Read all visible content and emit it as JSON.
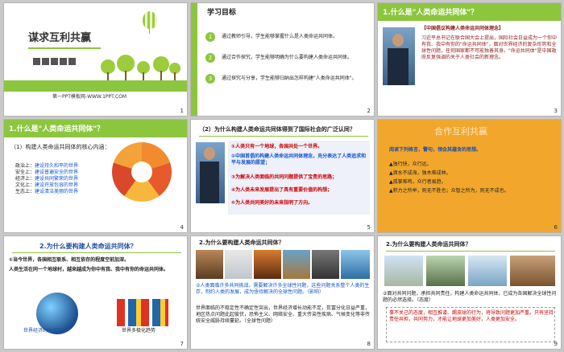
{
  "slides": [
    {
      "num": "1",
      "title": "谋求互利共赢",
      "footer": "第一PPT模板网-WWW.1PPT.COM"
    },
    {
      "num": "2",
      "title": "学习目标",
      "items": [
        "通过教师引导，学生能够掌握什么是人类命运共同体。",
        "通过合作探究，学生能够明确为什么要构建人类命运共同体。",
        "通过探究与分享，学生能够归纳出怎样构建\"人类命运共同体\"。"
      ]
    },
    {
      "num": "3",
      "title": "1.什么是\"人类命运共同体\"？",
      "box_title": "【中国倡议构建人类命运共同体理念】",
      "box_text": "习近平总书记在联合国大会上提出，国际社会日益成为一个你中有我、我中有你的\"命运共同体\"，面对世界经济的复杂形势和全球性问题，任何国家都不可能独善其身。\"命运共同体\"是中国政府反复强调的关于人类社会的新理念。"
    },
    {
      "num": "4",
      "title": "1.什么是\"人类命运共同体\"？",
      "sub": "（1）构建人类命运共同体的核心内涵：",
      "items": [
        {
          "k": "政治上：",
          "v": "建设持久和平的世界"
        },
        {
          "k": "安全上：",
          "v": "建设普遍安全的世界"
        },
        {
          "k": "经济上：",
          "v": "建设共同繁荣的世界"
        },
        {
          "k": "文化上：",
          "v": "建设开放包容的世界"
        },
        {
          "k": "生态上：",
          "v": "建设清洁美丽的世界"
        }
      ]
    },
    {
      "num": "5",
      "title": "（2）为什么构建人类命运共同体得到了国际社会的广泛认同？",
      "items": [
        "①人类只有一个地球，各国共处一个世界。",
        "②中国首倡的构建人类命运共同体理念，充分表达了人类追求和平与发展的愿望；",
        "③为解决人类面临的共同问题提供了宝贵的思路；",
        "④为人类未来发展提出了具有重要价值的构想；",
        "⑤为人类共同美好的未来指明了方向。"
      ]
    },
    {
      "num": "6",
      "title": "合作互利共赢",
      "lead": "阅读下列格言、警句，领会其蕴含的思想。",
      "items": [
        "▲独行快，众行远。",
        "▲滴水不成海，独木难成林。",
        "▲孤掌难鸣，众行者易趋。",
        "▲积力之所举，则无不胜也；众智之所为，则无不成也。"
      ]
    },
    {
      "num": "7",
      "title": "2.为什么要构建人类命运共同体？",
      "text1": "①当今世界，各国相互联系、相互依存的程度空前加深。",
      "text2": "人类生活在同一个地球村，越来越成为你中有我、我中有你的命运共同体。",
      "cap1": "世界经济的全球化",
      "cap2": "世界多极化趋势"
    },
    {
      "num": "8",
      "title": "2.为什么要构建人类命运共同体？",
      "text1": "②人类面临许多共同挑战，需要解决许多全球性问题，这些问题关系整个人类的生存，制约人类的发展，成为亟待解决的全球性问题。（影响）",
      "text2": "世界面临的不稳定性不确定性突出，世界经济增长动能不足，贫富分化日益严重，地区热点问题此起彼伏，恐怖主义、网络安全、重大传染性疾病、气候变化等非传统安全威胁持续蔓延。（全球性问题）"
    },
    {
      "num": "9",
      "title": "2.为什么要构建人类命运共同体？",
      "text1": "③面对共同问题，承担共同责任，构建人类命运共同体，已成为各国解决全球性问题的必然选择。（态度）",
      "text2": "事不关己的态度，相互推诿、踢皮球的行为，将导致问题更加严重。只有坚持责任共担，共同努力，才能让地球更加美好，人类更加安全。"
    }
  ]
}
